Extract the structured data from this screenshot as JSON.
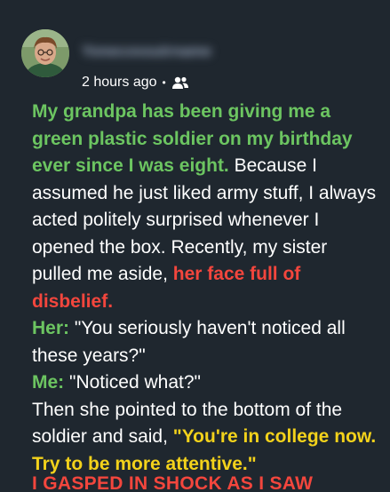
{
  "post": {
    "username": "Yonecossutrname",
    "timestamp": "2 hours ago",
    "separator": "•",
    "audience_icon": "friends-icon",
    "avatar_icon": "profile-photo"
  },
  "story": {
    "intro": "My grandpa has been giving me a green plastic soldier on my birthday ever since I was eight.",
    "para1_a": " Because I assumed he just liked army stuff, I always acted politely surprised whenever I opened the box. Recently, my sister pulled me aside, ",
    "para1_red": "her face full of disbelief.",
    "her_label": "Her:",
    "her_line": " \"You seriously haven't noticed all these years?\"",
    "me_label": "Me:",
    "me_line": " \"Noticed what?\"",
    "para2_a": "Then she pointed to the bottom of the soldier and said, ",
    "para2_yellow": "\"You're in college now. Try to be more attentive.\"",
    "cutoff": "I GASPED IN SHOCK AS I SAW"
  },
  "colors": {
    "background": "#1f272f",
    "green": "#6cc561",
    "red": "#f3463d",
    "yellow": "#f3d21b"
  }
}
